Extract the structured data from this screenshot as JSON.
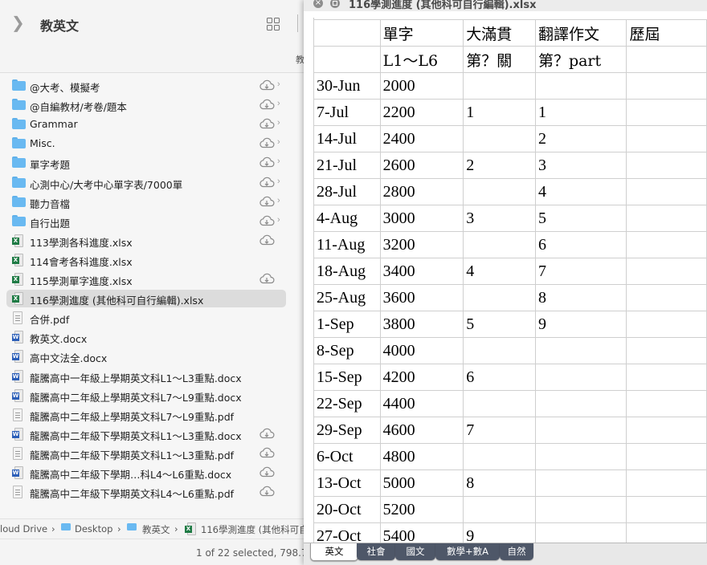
{
  "finder": {
    "title": "教英文",
    "toolbar_clipped_text": "教",
    "items": [
      {
        "name": "@大考、模擬考",
        "type": "folder",
        "cloud": true,
        "chevron": true
      },
      {
        "name": "@自編教材/考卷/題本",
        "type": "folder",
        "cloud": true,
        "chevron": true
      },
      {
        "name": "Grammar",
        "type": "folder",
        "cloud": true,
        "chevron": true
      },
      {
        "name": "Misc.",
        "type": "folder",
        "cloud": true,
        "chevron": true
      },
      {
        "name": "單字考題",
        "type": "folder",
        "cloud": true,
        "chevron": true
      },
      {
        "name": "心測中心/大考中心單字表/7000單",
        "type": "folder",
        "cloud": true,
        "chevron": true
      },
      {
        "name": "聽力音檔",
        "type": "folder",
        "cloud": true,
        "chevron": true
      },
      {
        "name": "自行出題",
        "type": "folder",
        "cloud": true,
        "chevron": true
      },
      {
        "name": "113學測各科進度.xlsx",
        "type": "xlsx",
        "cloud": true,
        "chevron": false
      },
      {
        "name": "114會考各科進度.xlsx",
        "type": "xlsx",
        "cloud": false,
        "chevron": false
      },
      {
        "name": "115學測單字進度.xlsx",
        "type": "xlsx",
        "cloud": true,
        "chevron": false
      },
      {
        "name": "116學測進度 (其他科可自行編輯).xlsx",
        "type": "xlsx",
        "cloud": false,
        "chevron": false,
        "selected": true
      },
      {
        "name": "合併.pdf",
        "type": "pdf",
        "cloud": false,
        "chevron": false
      },
      {
        "name": "教英文.docx",
        "type": "docx",
        "cloud": false,
        "chevron": false
      },
      {
        "name": "高中文法全.docx",
        "type": "docx",
        "cloud": false,
        "chevron": false
      },
      {
        "name": "龍騰高中一年級上學期英文科L1～L3重點.docx",
        "type": "docx",
        "cloud": false,
        "chevron": false
      },
      {
        "name": "龍騰高中二年級上學期英文科L7～L9重點.docx",
        "type": "docx",
        "cloud": false,
        "chevron": false
      },
      {
        "name": "龍騰高中二年級上學期英文科L7～L9重點.pdf",
        "type": "pdf",
        "cloud": false,
        "chevron": false
      },
      {
        "name": "龍騰高中二年級下學期英文科L1～L3重點.docx",
        "type": "docx",
        "cloud": true,
        "chevron": false
      },
      {
        "name": "龍騰高中二年級下學期英文科L1～L3重點.pdf",
        "type": "pdf",
        "cloud": true,
        "chevron": false
      },
      {
        "name": "龍騰高中二年級下學期…科L4～L6重點.docx",
        "type": "docx",
        "cloud": true,
        "chevron": false
      },
      {
        "name": "龍騰高中二年級下學期英文科L4～L6重點.pdf",
        "type": "pdf",
        "cloud": true,
        "chevron": false
      }
    ],
    "path": [
      "loud Drive",
      "Desktop",
      "教英文",
      "116學測進度 (其他科可自"
    ],
    "status": "1 of 22 selected, 798.7"
  },
  "quicklook": {
    "title": "116學測進度 (其他科可自行編輯).xlsx",
    "header_row1": [
      "",
      "單字",
      "大滿貫",
      "翻譯作文",
      "歷屆"
    ],
    "header_row2": [
      "",
      "L1～L6",
      "第？關",
      "第？part",
      ""
    ],
    "rows": [
      [
        "30-Jun",
        "2000",
        "",
        "",
        ""
      ],
      [
        "7-Jul",
        "2200",
        "1",
        "1",
        ""
      ],
      [
        "14-Jul",
        "2400",
        "",
        "2",
        ""
      ],
      [
        "21-Jul",
        "2600",
        "2",
        "3",
        ""
      ],
      [
        "28-Jul",
        "2800",
        "",
        "4",
        ""
      ],
      [
        "4-Aug",
        "3000",
        "3",
        "5",
        ""
      ],
      [
        "11-Aug",
        "3200",
        "",
        "6",
        ""
      ],
      [
        "18-Aug",
        "3400",
        "4",
        "7",
        ""
      ],
      [
        "25-Aug",
        "3600",
        "",
        "8",
        ""
      ],
      [
        "1-Sep",
        "3800",
        "5",
        "9",
        ""
      ],
      [
        "8-Sep",
        "4000",
        "",
        "",
        ""
      ],
      [
        "15-Sep",
        "4200",
        "6",
        "",
        ""
      ],
      [
        "22-Sep",
        "4400",
        "",
        "",
        ""
      ],
      [
        "29-Sep",
        "4600",
        "7",
        "",
        ""
      ],
      [
        "6-Oct",
        "4800",
        "",
        "",
        ""
      ],
      [
        "13-Oct",
        "5000",
        "8",
        "",
        ""
      ],
      [
        "20-Oct",
        "5200",
        "",
        "",
        ""
      ],
      [
        "27-Oct",
        "5400",
        "9",
        "",
        ""
      ]
    ],
    "sheet_tabs": [
      {
        "label": "英文",
        "active": true
      },
      {
        "label": "社會",
        "active": false
      },
      {
        "label": "國文",
        "active": false
      },
      {
        "label": "數學+數A",
        "active": false
      },
      {
        "label": "自然",
        "active": false
      }
    ]
  }
}
